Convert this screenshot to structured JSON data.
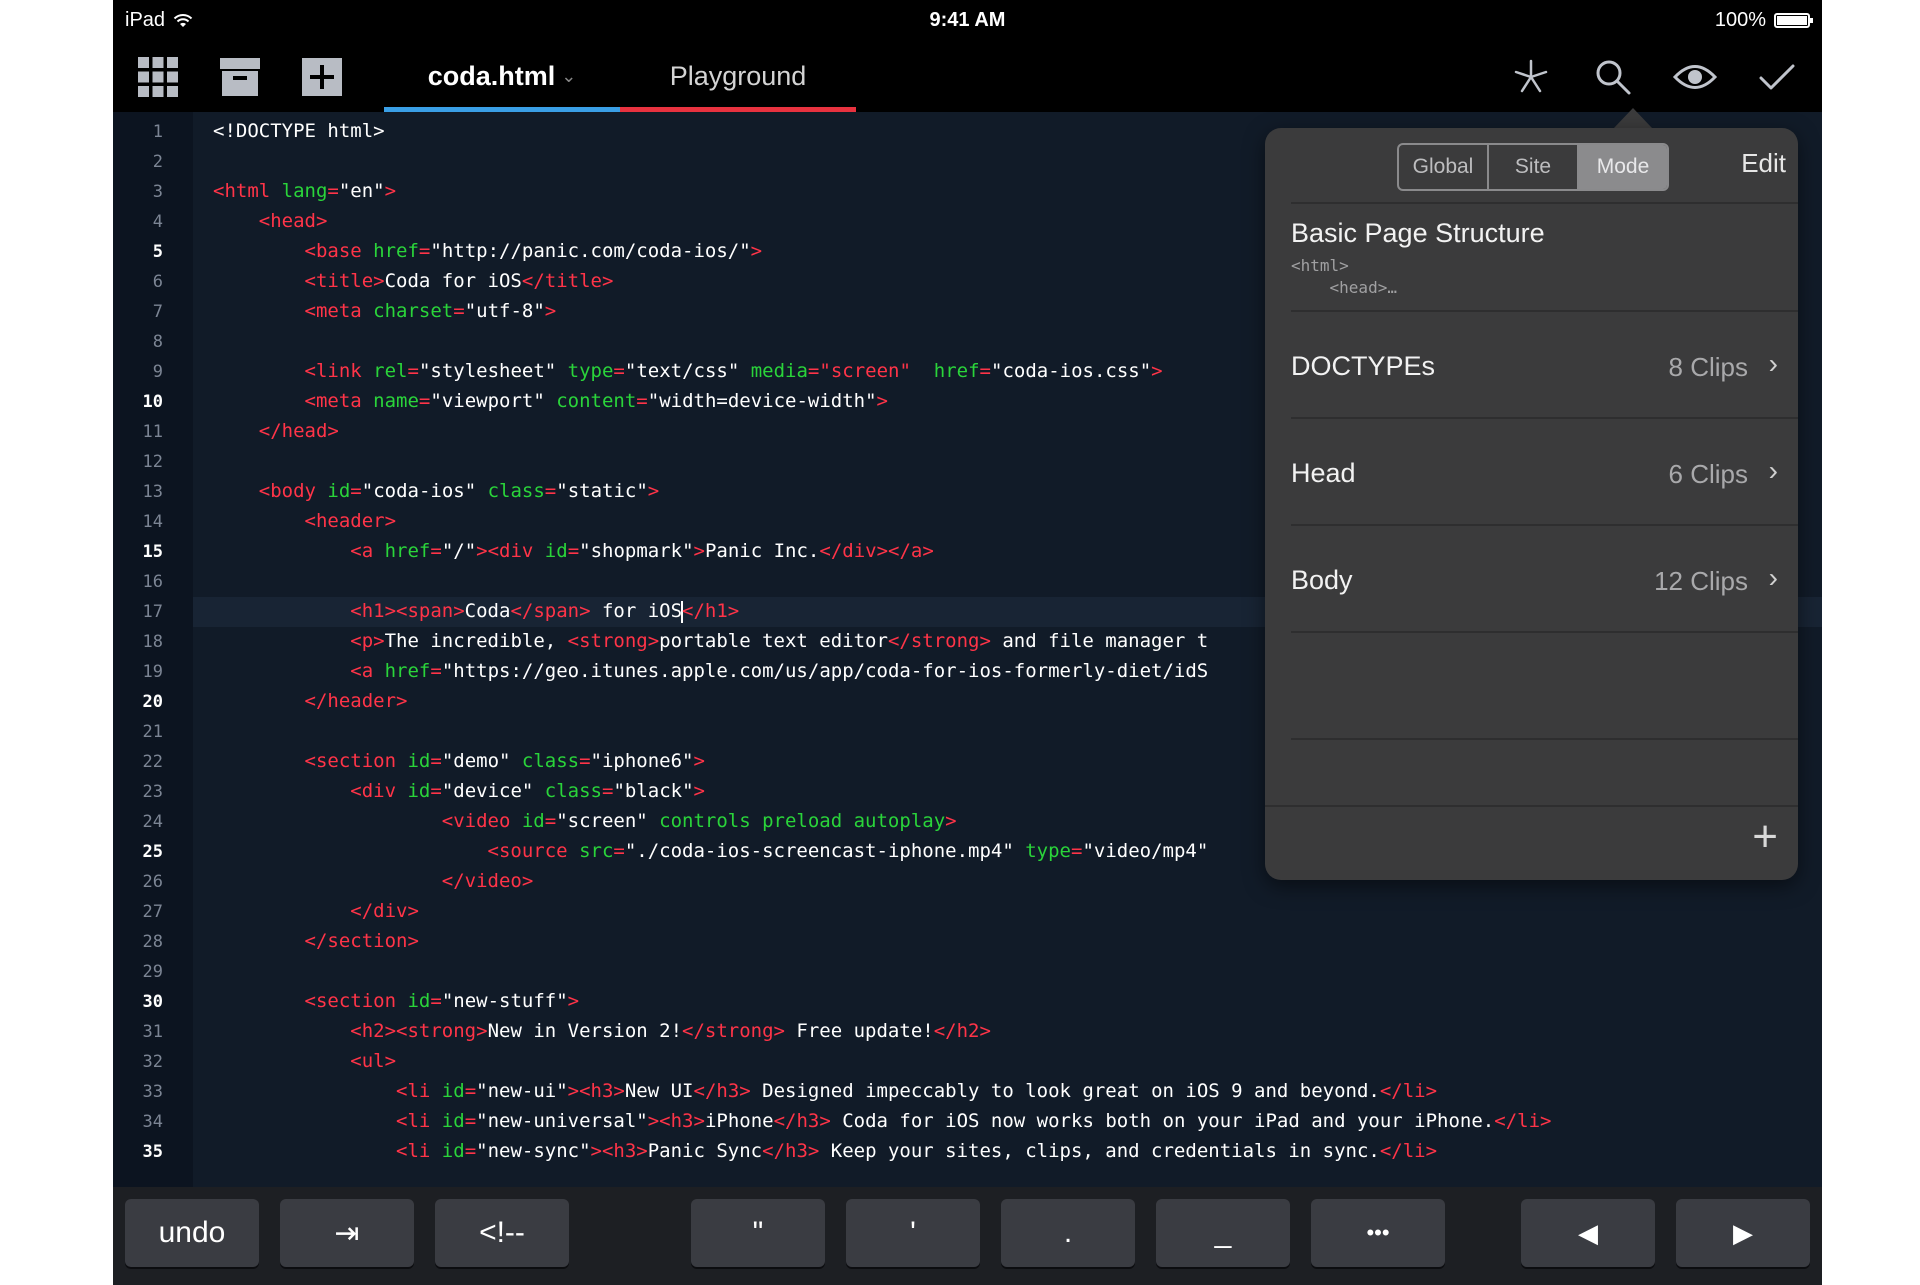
{
  "status_bar": {
    "device": "iPad",
    "time": "9:41 AM",
    "battery": "100%"
  },
  "toolbar": {
    "tabs": [
      {
        "label": "coda.html",
        "caret": "⌄",
        "underline_color": "#3a9fe6"
      },
      {
        "label": "Playground",
        "underline_color": "#e8323f"
      }
    ],
    "left_icons": [
      "grid-icon",
      "archive-icon",
      "add-file-icon"
    ],
    "right_icons": [
      "clips-icon",
      "search-icon",
      "preview-eye-icon",
      "checkmark-icon"
    ]
  },
  "editor": {
    "highlighted_line": 17,
    "line_numbers": [
      "1",
      "2",
      "3",
      "4",
      "5",
      "6",
      "7",
      "8",
      "9",
      "10",
      "11",
      "12",
      "13",
      "14",
      "15",
      "16",
      "17",
      "18",
      "19",
      "20",
      "21",
      "22",
      "23",
      "24",
      "25",
      "26",
      "27",
      "28",
      "29",
      "30",
      "31",
      "32",
      "33",
      "34",
      "35"
    ],
    "bold_lines": [
      5,
      10,
      15,
      20,
      25,
      30,
      35
    ],
    "lines": [
      [
        [
          "v",
          "<!DOCTYPE html>"
        ]
      ],
      [],
      [
        [
          "t",
          "<html "
        ],
        [
          "a",
          "lang"
        ],
        [
          "t",
          "="
        ],
        [
          "v",
          "\"en\""
        ],
        [
          "t",
          ">"
        ]
      ],
      [
        [
          "v",
          "    "
        ],
        [
          "t",
          "<head>"
        ]
      ],
      [
        [
          "v",
          "        "
        ],
        [
          "t",
          "<base "
        ],
        [
          "a",
          "href"
        ],
        [
          "t",
          "="
        ],
        [
          "v",
          "\"http://panic.com/coda-ios/\""
        ],
        [
          "t",
          ">"
        ]
      ],
      [
        [
          "v",
          "        "
        ],
        [
          "t",
          "<title>"
        ],
        [
          "v",
          "Coda for iOS"
        ],
        [
          "t",
          "</title>"
        ]
      ],
      [
        [
          "v",
          "        "
        ],
        [
          "t",
          "<meta "
        ],
        [
          "a",
          "charset"
        ],
        [
          "t",
          "="
        ],
        [
          "v",
          "\"utf-8\""
        ],
        [
          "t",
          ">"
        ]
      ],
      [],
      [
        [
          "v",
          "        "
        ],
        [
          "t",
          "<link "
        ],
        [
          "a",
          "rel"
        ],
        [
          "t",
          "="
        ],
        [
          "v",
          "\"stylesheet\" "
        ],
        [
          "a",
          "type"
        ],
        [
          "t",
          "="
        ],
        [
          "v",
          "\"text/css\" "
        ],
        [
          "a",
          "media"
        ],
        [
          "t",
          "="
        ],
        [
          "t",
          "\"screen\""
        ],
        [
          "v",
          "  "
        ],
        [
          "a",
          "href"
        ],
        [
          "t",
          "="
        ],
        [
          "v",
          "\"coda-ios.css\""
        ],
        [
          "t",
          ">"
        ]
      ],
      [
        [
          "v",
          "        "
        ],
        [
          "t",
          "<meta "
        ],
        [
          "a",
          "name"
        ],
        [
          "t",
          "="
        ],
        [
          "v",
          "\"viewport\" "
        ],
        [
          "a",
          "content"
        ],
        [
          "t",
          "="
        ],
        [
          "v",
          "\"width=device-width\""
        ],
        [
          "t",
          ">"
        ]
      ],
      [
        [
          "v",
          "    "
        ],
        [
          "t",
          "</head>"
        ]
      ],
      [],
      [
        [
          "v",
          "    "
        ],
        [
          "t",
          "<body "
        ],
        [
          "a",
          "id"
        ],
        [
          "t",
          "="
        ],
        [
          "v",
          "\"coda-ios\" "
        ],
        [
          "a",
          "class"
        ],
        [
          "t",
          "="
        ],
        [
          "v",
          "\"static\""
        ],
        [
          "t",
          ">"
        ]
      ],
      [
        [
          "v",
          "        "
        ],
        [
          "t",
          "<header>"
        ]
      ],
      [
        [
          "v",
          "            "
        ],
        [
          "t",
          "<a "
        ],
        [
          "a",
          "href"
        ],
        [
          "t",
          "="
        ],
        [
          "v",
          "\"/\""
        ],
        [
          "t",
          "><div "
        ],
        [
          "a",
          "id"
        ],
        [
          "t",
          "="
        ],
        [
          "v",
          "\"shopmark\""
        ],
        [
          "t",
          ">"
        ],
        [
          "v",
          "Panic Inc."
        ],
        [
          "t",
          "</div></a>"
        ]
      ],
      [],
      [
        [
          "v",
          "            "
        ],
        [
          "t",
          "<h1><span>"
        ],
        [
          "v",
          "Coda"
        ],
        [
          "t",
          "</span>"
        ],
        [
          "v",
          " for iOS"
        ],
        [
          "c",
          ""
        ],
        [
          "t",
          "</h1>"
        ]
      ],
      [
        [
          "v",
          "            "
        ],
        [
          "t",
          "<p>"
        ],
        [
          "v",
          "The incredible, "
        ],
        [
          "t",
          "<strong>"
        ],
        [
          "v",
          "portable text editor"
        ],
        [
          "t",
          "</strong>"
        ],
        [
          "v",
          " and file manager t"
        ]
      ],
      [
        [
          "v",
          "            "
        ],
        [
          "t",
          "<a "
        ],
        [
          "a",
          "href"
        ],
        [
          "t",
          "="
        ],
        [
          "v",
          "\"https://geo.itunes.apple.com/us/app/coda-for-ios-formerly-diet/idS"
        ]
      ],
      [
        [
          "v",
          "        "
        ],
        [
          "t",
          "</header>"
        ]
      ],
      [],
      [
        [
          "v",
          "        "
        ],
        [
          "t",
          "<section "
        ],
        [
          "a",
          "id"
        ],
        [
          "t",
          "="
        ],
        [
          "v",
          "\"demo\" "
        ],
        [
          "a",
          "class"
        ],
        [
          "t",
          "="
        ],
        [
          "v",
          "\"iphone6\""
        ],
        [
          "t",
          ">"
        ]
      ],
      [
        [
          "v",
          "            "
        ],
        [
          "t",
          "<div "
        ],
        [
          "a",
          "id"
        ],
        [
          "t",
          "="
        ],
        [
          "v",
          "\"device\" "
        ],
        [
          "a",
          "class"
        ],
        [
          "t",
          "="
        ],
        [
          "v",
          "\"black\""
        ],
        [
          "t",
          ">"
        ]
      ],
      [
        [
          "v",
          "                    "
        ],
        [
          "t",
          "<video "
        ],
        [
          "a",
          "id"
        ],
        [
          "t",
          "="
        ],
        [
          "v",
          "\"screen\" "
        ],
        [
          "a",
          "controls preload autoplay"
        ],
        [
          "t",
          ">"
        ]
      ],
      [
        [
          "v",
          "                        "
        ],
        [
          "t",
          "<source "
        ],
        [
          "a",
          "src"
        ],
        [
          "t",
          "="
        ],
        [
          "v",
          "\"./coda-ios-screencast-iphone.mp4\" "
        ],
        [
          "a",
          "type"
        ],
        [
          "t",
          "="
        ],
        [
          "v",
          "\"video/mp4\""
        ]
      ],
      [
        [
          "v",
          "                    "
        ],
        [
          "t",
          "</video>"
        ]
      ],
      [
        [
          "v",
          "            "
        ],
        [
          "t",
          "</div>"
        ]
      ],
      [
        [
          "v",
          "        "
        ],
        [
          "t",
          "</section>"
        ]
      ],
      [],
      [
        [
          "v",
          "        "
        ],
        [
          "t",
          "<section "
        ],
        [
          "a",
          "id"
        ],
        [
          "t",
          "="
        ],
        [
          "v",
          "\"new-stuff\""
        ],
        [
          "t",
          ">"
        ]
      ],
      [
        [
          "v",
          "            "
        ],
        [
          "t",
          "<h2><strong>"
        ],
        [
          "v",
          "New in Version 2!"
        ],
        [
          "t",
          "</strong>"
        ],
        [
          "v",
          " Free update!"
        ],
        [
          "t",
          "</h2>"
        ]
      ],
      [
        [
          "v",
          "            "
        ],
        [
          "t",
          "<ul>"
        ]
      ],
      [
        [
          "v",
          "                "
        ],
        [
          "t",
          "<li "
        ],
        [
          "a",
          "id"
        ],
        [
          "t",
          "="
        ],
        [
          "v",
          "\"new-ui\""
        ],
        [
          "t",
          "><h3>"
        ],
        [
          "v",
          "New UI"
        ],
        [
          "t",
          "</h3>"
        ],
        [
          "v",
          " Designed impeccably to look great on iOS 9 and beyond."
        ],
        [
          "t",
          "</li>"
        ]
      ],
      [
        [
          "v",
          "                "
        ],
        [
          "t",
          "<li "
        ],
        [
          "a",
          "id"
        ],
        [
          "t",
          "="
        ],
        [
          "v",
          "\"new-universal\""
        ],
        [
          "t",
          "><h3>"
        ],
        [
          "v",
          "iPhone"
        ],
        [
          "t",
          "</h3>"
        ],
        [
          "v",
          " Coda for iOS now works both on your iPad and your iPhone."
        ],
        [
          "t",
          "</li>"
        ]
      ],
      [
        [
          "v",
          "                "
        ],
        [
          "t",
          "<li "
        ],
        [
          "a",
          "id"
        ],
        [
          "t",
          "="
        ],
        [
          "v",
          "\"new-sync\""
        ],
        [
          "t",
          "><h3>"
        ],
        [
          "v",
          "Panic Sync"
        ],
        [
          "t",
          "</h3>"
        ],
        [
          "v",
          " Keep your sites, clips, and credentials in sync."
        ],
        [
          "t",
          "</li>"
        ]
      ]
    ]
  },
  "clips_popover": {
    "segments": [
      "Global",
      "Site",
      "Mode"
    ],
    "selected_segment": "Mode",
    "edit_label": "Edit",
    "featured": {
      "title": "Basic Page Structure",
      "preview_line1": "<html>",
      "preview_line2": "    <head>…"
    },
    "groups": [
      {
        "title": "DOCTYPEs",
        "count": "8 Clips"
      },
      {
        "title": "Head",
        "count": "6 Clips"
      },
      {
        "title": "Body",
        "count": "12 Clips"
      }
    ],
    "add_label": "+"
  },
  "accessory_bar": {
    "keys": [
      "undo",
      "⇥",
      "<!--",
      "\"",
      "'",
      ".",
      "_",
      "•••",
      "◀",
      "▶"
    ]
  }
}
